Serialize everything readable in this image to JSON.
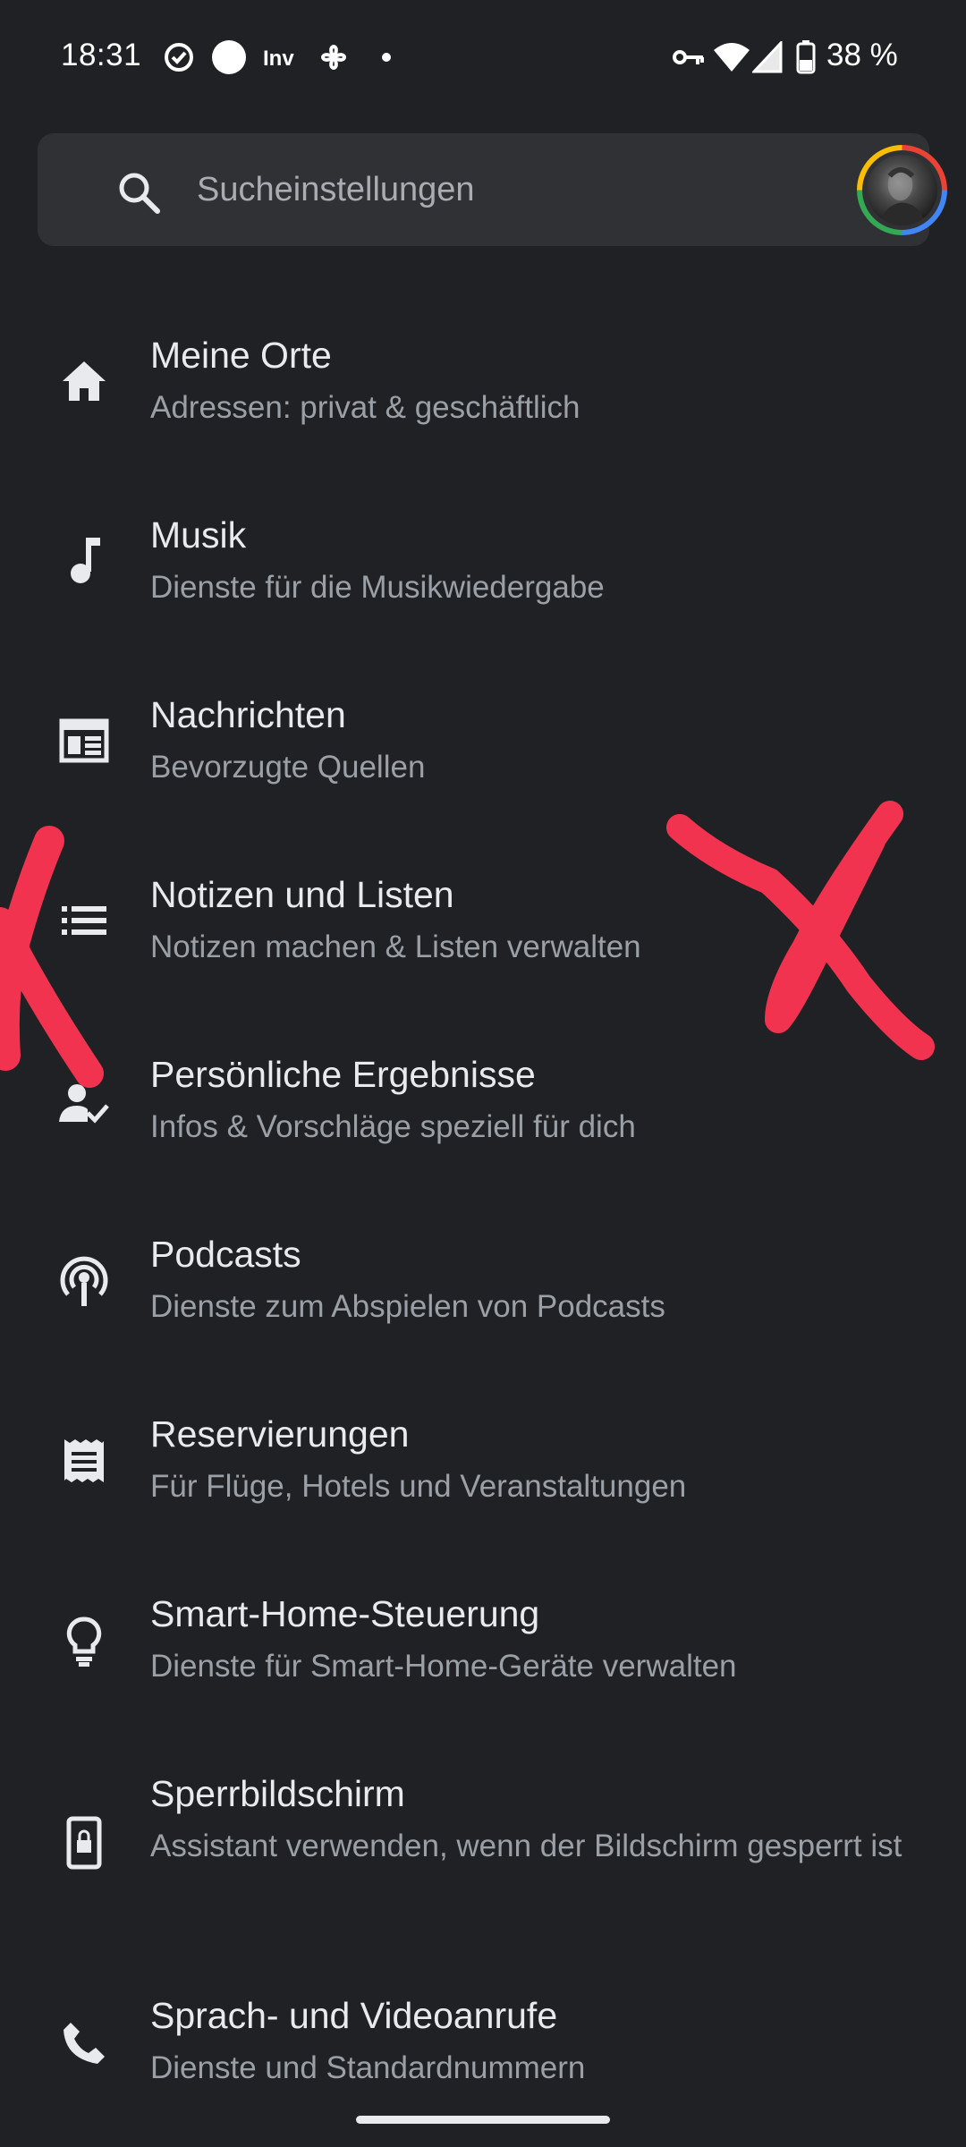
{
  "status_bar": {
    "time": "18:31",
    "battery": "38 %",
    "icons": [
      "check-circle-icon",
      "circle-icon",
      "inv-icon",
      "pinwheel-icon",
      "dot-icon",
      "vpn-key-icon",
      "wifi-icon",
      "signal-icon",
      "battery-icon"
    ]
  },
  "search": {
    "placeholder": "Sucheinstellungen",
    "icon": "search-icon"
  },
  "settings": [
    {
      "title": "Meine Orte",
      "subtitle": "Adressen: privat & geschäftlich",
      "icon": "home-icon"
    },
    {
      "title": "Musik",
      "subtitle": "Dienste für die Musikwiedergabe",
      "icon": "music-note-icon"
    },
    {
      "title": "Nachrichten",
      "subtitle": "Bevorzugte Quellen",
      "icon": "newspaper-icon"
    },
    {
      "title": "Notizen und Listen",
      "subtitle": "Notizen machen & Listen verwalten",
      "icon": "list-icon"
    },
    {
      "title": "Persönliche Ergebnisse",
      "subtitle": "Infos & Vorschläge speziell für dich",
      "icon": "person-check-icon"
    },
    {
      "title": "Podcasts",
      "subtitle": "Dienste zum Abspielen von Podcasts",
      "icon": "podcast-icon"
    },
    {
      "title": "Reservierungen",
      "subtitle": "Für Flüge, Hotels und Veranstaltungen",
      "icon": "receipt-icon"
    },
    {
      "title": "Smart-Home-Steuerung",
      "subtitle": "Dienste für Smart-Home-Geräte verwalten",
      "icon": "lightbulb-icon"
    },
    {
      "title": "Sperrbildschirm",
      "subtitle": "Assistant verwenden, wenn der Bildschirm gesperrt ist",
      "icon": "lock-screen-icon"
    },
    {
      "title": "Sprach- und Videoanrufe",
      "subtitle": "Dienste und Standardnummern",
      "icon": "phone-icon"
    }
  ],
  "colors": {
    "background": "#202124",
    "search_bg": "#303134",
    "title": "#e8eaed",
    "subtitle": "#9aa0a6",
    "annotation": "#f2334f"
  }
}
